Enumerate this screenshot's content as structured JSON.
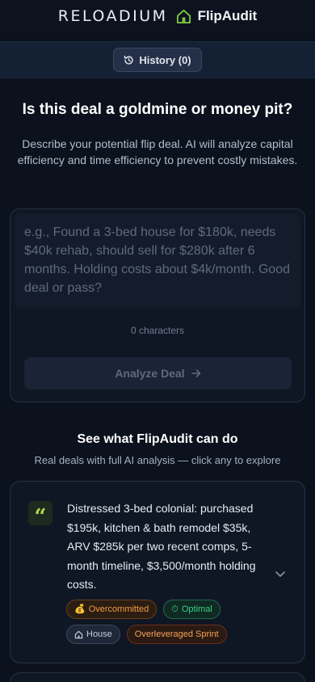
{
  "header": {
    "brand": "RELOADIUM",
    "app_name": "FlipAudit",
    "accent_color": "#7cc241"
  },
  "toolbar": {
    "history_label": "History (0)"
  },
  "hero": {
    "title": "Is this deal a goldmine or money pit?",
    "description": "Describe your potential flip deal. AI will analyze capital efficiency and time efficiency to prevent costly mistakes."
  },
  "input": {
    "placeholder": "e.g., Found a 3-bed house for $180k, needs $40k rehab, should sell for $280k after 6 months. Holding costs about $4k/month. Good deal or pass?",
    "value": "",
    "char_count": "0 characters",
    "analyze_label": "Analyze Deal"
  },
  "explore": {
    "title": "See what FlipAudit can do",
    "subtitle": "Real deals with full AI analysis — click any to explore"
  },
  "examples": [
    {
      "text": "Distressed 3-bed colonial: purchased $195k, kitchen & bath remodel $35k, ARV $285k per two recent comps, 5-month timeline, $3,500/month holding costs.",
      "tags": [
        {
          "icon": "money-bag-icon",
          "label": "Overcommitted"
        },
        {
          "icon": "stopwatch-icon",
          "label": "Optimal"
        },
        {
          "icon": "house-icon",
          "label": "House"
        },
        {
          "icon": "",
          "label": "Overleveraged Sprint"
        }
      ]
    }
  ]
}
